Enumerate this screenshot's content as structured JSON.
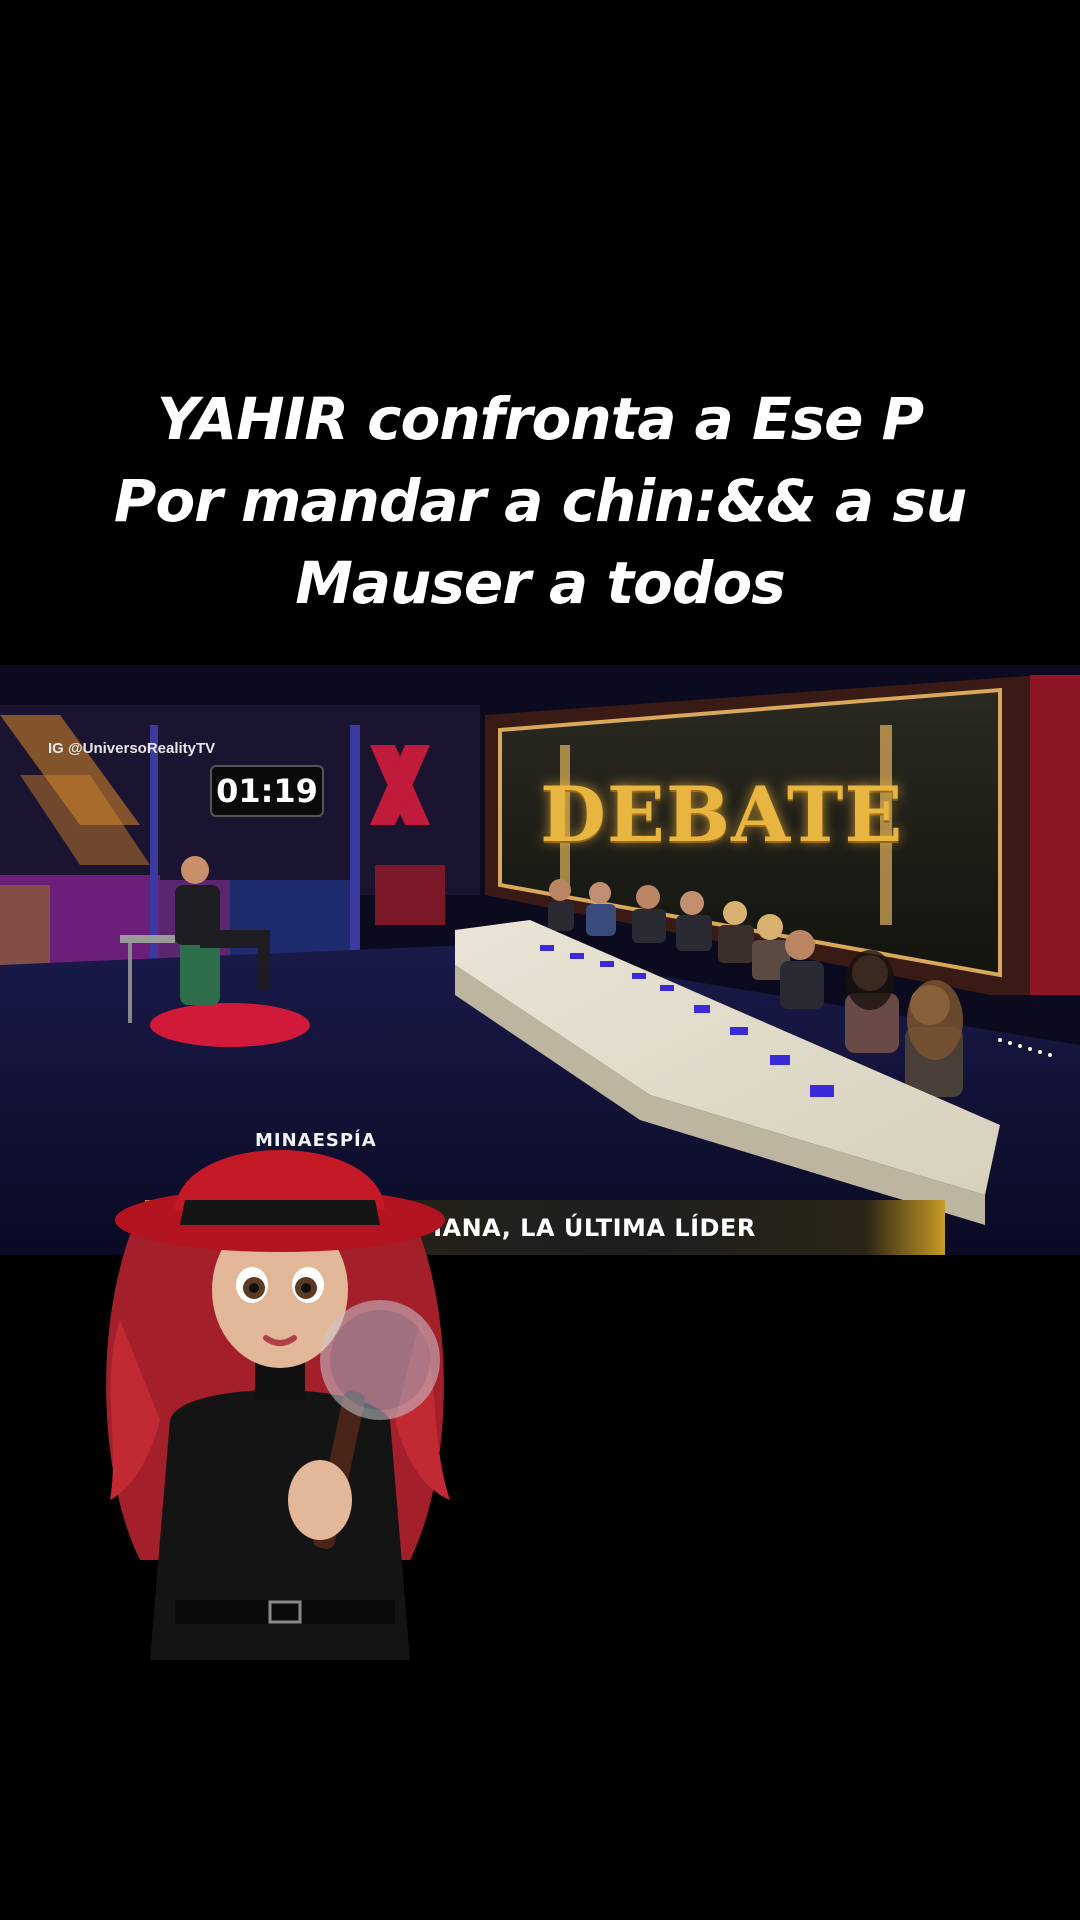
{
  "caption": {
    "line1": "YAHIR confronta a Ese P",
    "line2": "Por mandar a chin:&& a su",
    "line3": "Mauser a todos"
  },
  "video": {
    "watermark": "IG @UniversoRealityTV",
    "timer": "01:19",
    "set_sign": "DEBATE",
    "lower_third": "PIANA, LA ÚLTIMA LÍDER",
    "hat_label": "MINAESPÍA"
  },
  "colors": {
    "background": "#000000",
    "caption_text": "#ffffff",
    "gold": "#e8b640",
    "hat_red": "#b3141f",
    "hair_red": "#a3202a"
  }
}
